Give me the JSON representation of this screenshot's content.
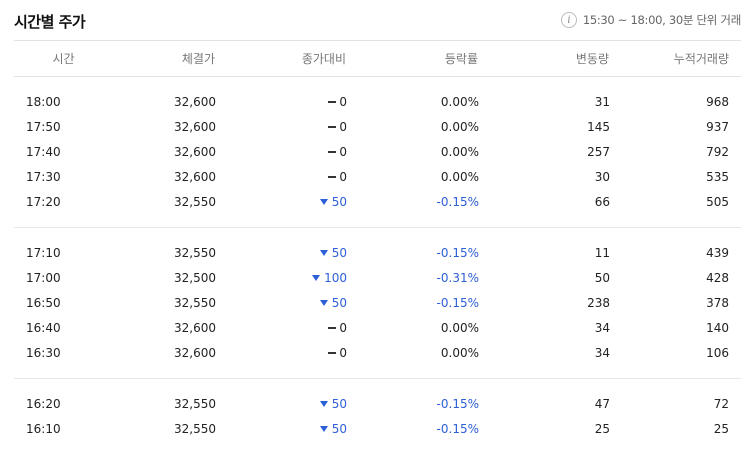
{
  "header": {
    "title": "시간별 주가",
    "info_text": "15:30 ~ 18:00, 30분 단위 거래",
    "info_icon": "info-icon"
  },
  "columns": [
    "시간",
    "체결가",
    "종가대비",
    "등락률",
    "변동량",
    "누적거래량"
  ],
  "groups": [
    [
      {
        "time": "18:00",
        "price": "32,600",
        "dir": "flat",
        "change": "0",
        "rate": "0.00%",
        "volume": "31",
        "cumulative": "968"
      },
      {
        "time": "17:50",
        "price": "32,600",
        "dir": "flat",
        "change": "0",
        "rate": "0.00%",
        "volume": "145",
        "cumulative": "937"
      },
      {
        "time": "17:40",
        "price": "32,600",
        "dir": "flat",
        "change": "0",
        "rate": "0.00%",
        "volume": "257",
        "cumulative": "792"
      },
      {
        "time": "17:30",
        "price": "32,600",
        "dir": "flat",
        "change": "0",
        "rate": "0.00%",
        "volume": "30",
        "cumulative": "535"
      },
      {
        "time": "17:20",
        "price": "32,550",
        "dir": "down",
        "change": "50",
        "rate": "-0.15%",
        "volume": "66",
        "cumulative": "505"
      }
    ],
    [
      {
        "time": "17:10",
        "price": "32,550",
        "dir": "down",
        "change": "50",
        "rate": "-0.15%",
        "volume": "11",
        "cumulative": "439"
      },
      {
        "time": "17:00",
        "price": "32,500",
        "dir": "down",
        "change": "100",
        "rate": "-0.31%",
        "volume": "50",
        "cumulative": "428"
      },
      {
        "time": "16:50",
        "price": "32,550",
        "dir": "down",
        "change": "50",
        "rate": "-0.15%",
        "volume": "238",
        "cumulative": "378"
      },
      {
        "time": "16:40",
        "price": "32,600",
        "dir": "flat",
        "change": "0",
        "rate": "0.00%",
        "volume": "34",
        "cumulative": "140"
      },
      {
        "time": "16:30",
        "price": "32,600",
        "dir": "flat",
        "change": "0",
        "rate": "0.00%",
        "volume": "34",
        "cumulative": "106"
      }
    ],
    [
      {
        "time": "16:20",
        "price": "32,550",
        "dir": "down",
        "change": "50",
        "rate": "-0.15%",
        "volume": "47",
        "cumulative": "72"
      },
      {
        "time": "16:10",
        "price": "32,550",
        "dir": "down",
        "change": "50",
        "rate": "-0.15%",
        "volume": "25",
        "cumulative": "25"
      }
    ]
  ],
  "colors": {
    "down": "#2d5fd6",
    "flat": "#222222",
    "border": "#e2e2e2"
  }
}
